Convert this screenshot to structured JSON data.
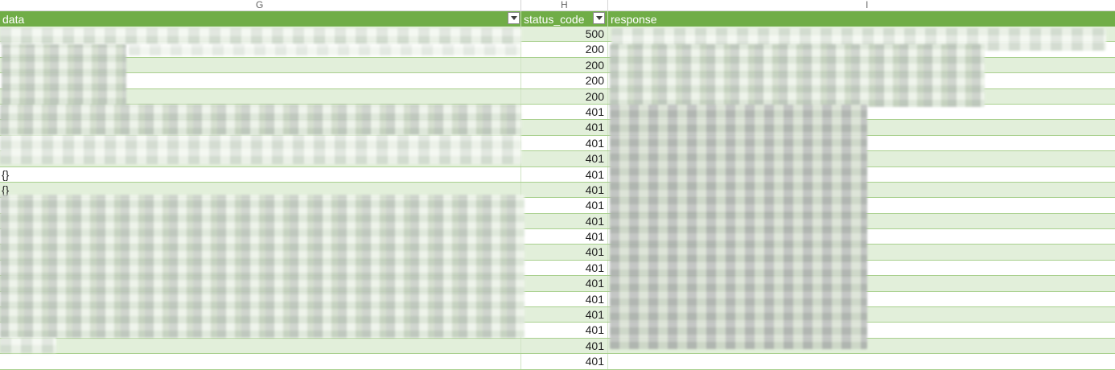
{
  "sheet": {
    "column_letters": [
      "G",
      "H",
      "I"
    ],
    "header_color": "#70ad47",
    "band_color": "#e2efda",
    "columns": [
      {
        "key": "data",
        "label": "data"
      },
      {
        "key": "status_code",
        "label": "status_code"
      },
      {
        "key": "response",
        "label": "response"
      }
    ],
    "rows": [
      {
        "data": "",
        "status_code": "500",
        "response": ""
      },
      {
        "data": "",
        "status_code": "200",
        "response": ""
      },
      {
        "data": "",
        "status_code": "200",
        "response": ""
      },
      {
        "data": "",
        "status_code": "200",
        "response": ""
      },
      {
        "data": "",
        "status_code": "200",
        "response": ""
      },
      {
        "data": "",
        "status_code": "401",
        "response": ""
      },
      {
        "data": "",
        "status_code": "401",
        "response": ""
      },
      {
        "data": "",
        "status_code": "401",
        "response": ""
      },
      {
        "data": "",
        "status_code": "401",
        "response": ""
      },
      {
        "data": "{}",
        "status_code": "401",
        "response": ""
      },
      {
        "data": "{}",
        "status_code": "401",
        "response": ""
      },
      {
        "data": "",
        "status_code": "401",
        "response": ""
      },
      {
        "data": "",
        "status_code": "401",
        "response": ""
      },
      {
        "data": "",
        "status_code": "401",
        "response": ""
      },
      {
        "data": "",
        "status_code": "401",
        "response": ""
      },
      {
        "data": "",
        "status_code": "401",
        "response": ""
      },
      {
        "data": "",
        "status_code": "401",
        "response": ""
      },
      {
        "data": "",
        "status_code": "401",
        "response": ""
      },
      {
        "data": "",
        "status_code": "401",
        "response": ""
      },
      {
        "data": "",
        "status_code": "401",
        "response": ""
      },
      {
        "data": "",
        "status_code": "401",
        "response": ""
      },
      {
        "data": "",
        "status_code": "401",
        "response": ""
      }
    ]
  }
}
